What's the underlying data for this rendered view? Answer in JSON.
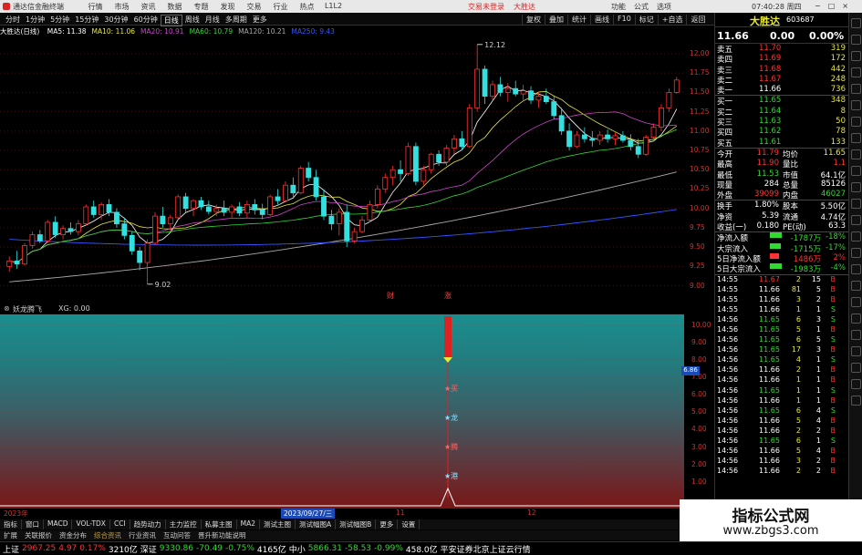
{
  "titlebar": {
    "app_title": "通达信金融终端",
    "menu": [
      "行情",
      "市场",
      "资讯",
      "数据",
      "专题",
      "发现",
      "交易",
      "行业",
      "热点",
      "L1L2"
    ],
    "links": [
      "交易未登录",
      "大胜达"
    ],
    "right_menu": [
      "功能",
      "公式",
      "选项"
    ],
    "clock": "07:40:28",
    "clock_label": "周四",
    "win_buttons": [
      "−",
      "□",
      "×"
    ]
  },
  "toolbar": {
    "periods": [
      "分时",
      "1分钟",
      "5分钟",
      "15分钟",
      "30分钟",
      "60分钟",
      "日线",
      "周线",
      "月线",
      "多周期",
      "更多"
    ],
    "active_period": "日线",
    "actions": [
      "复权",
      "叠加",
      "统计",
      "画线",
      "F10",
      "标记",
      "+自选",
      "返回"
    ]
  },
  "ma_line": {
    "title": "大胜达(日线)",
    "items": [
      {
        "label": "MA5: 11.38",
        "color": "#ffffff"
      },
      {
        "label": "MA10: 11.06",
        "color": "#e8e838"
      },
      {
        "label": "MA20: 10.91",
        "color": "#cc44cc"
      },
      {
        "label": "MA60: 10.79",
        "color": "#33d933"
      },
      {
        "label": "MA120: 10.21",
        "color": "#aaaaaa"
      },
      {
        "label": "MA250: 9.43",
        "color": "#3355ff"
      }
    ]
  },
  "chart_data": {
    "type": "candlestick",
    "ylim": [
      8.9,
      12.2
    ],
    "y_ticks": [
      "12.00",
      "11.75",
      "11.50",
      "11.25",
      "11.00",
      "10.75",
      "10.50",
      "10.25",
      "10.00",
      "9.75",
      "9.50",
      "9.25",
      "9.00"
    ],
    "annotations": [
      {
        "text": "12.12"
      },
      {
        "text": "9.02"
      }
    ],
    "candles": [
      {
        "o": 9.25,
        "h": 9.38,
        "l": 9.18,
        "c": 9.32
      },
      {
        "o": 9.32,
        "h": 9.45,
        "l": 9.22,
        "c": 9.28
      },
      {
        "o": 9.28,
        "h": 9.55,
        "l": 9.26,
        "c": 9.52
      },
      {
        "o": 9.52,
        "h": 9.7,
        "l": 9.48,
        "c": 9.66
      },
      {
        "o": 9.66,
        "h": 9.72,
        "l": 9.55,
        "c": 9.58
      },
      {
        "o": 9.58,
        "h": 9.85,
        "l": 9.55,
        "c": 9.82
      },
      {
        "o": 9.82,
        "h": 9.9,
        "l": 9.62,
        "c": 9.66
      },
      {
        "o": 9.66,
        "h": 9.78,
        "l": 9.6,
        "c": 9.74
      },
      {
        "o": 9.74,
        "h": 9.82,
        "l": 9.66,
        "c": 9.7
      },
      {
        "o": 9.7,
        "h": 9.85,
        "l": 9.65,
        "c": 9.8
      },
      {
        "o": 9.8,
        "h": 10.05,
        "l": 9.78,
        "c": 10.02
      },
      {
        "o": 10.02,
        "h": 10.1,
        "l": 9.88,
        "c": 9.92
      },
      {
        "o": 9.92,
        "h": 10.08,
        "l": 9.85,
        "c": 10.05
      },
      {
        "o": 10.05,
        "h": 10.12,
        "l": 9.9,
        "c": 9.95
      },
      {
        "o": 9.95,
        "h": 10.0,
        "l": 9.75,
        "c": 9.8
      },
      {
        "o": 9.8,
        "h": 9.88,
        "l": 9.6,
        "c": 9.65
      },
      {
        "o": 9.65,
        "h": 9.7,
        "l": 9.4,
        "c": 9.45
      },
      {
        "o": 9.45,
        "h": 9.5,
        "l": 9.2,
        "c": 9.3
      },
      {
        "o": 9.3,
        "h": 9.6,
        "l": 9.02,
        "c": 9.55
      },
      {
        "o": 9.55,
        "h": 9.95,
        "l": 9.52,
        "c": 9.9
      },
      {
        "o": 9.9,
        "h": 10.02,
        "l": 9.75,
        "c": 9.8
      },
      {
        "o": 9.8,
        "h": 9.92,
        "l": 9.7,
        "c": 9.88
      },
      {
        "o": 9.88,
        "h": 10.18,
        "l": 9.85,
        "c": 10.15
      },
      {
        "o": 10.15,
        "h": 10.2,
        "l": 9.95,
        "c": 10.0
      },
      {
        "o": 10.0,
        "h": 10.12,
        "l": 9.9,
        "c": 10.1
      },
      {
        "o": 10.1,
        "h": 10.15,
        "l": 9.98,
        "c": 10.02
      },
      {
        "o": 10.02,
        "h": 10.1,
        "l": 9.92,
        "c": 9.96
      },
      {
        "o": 9.96,
        "h": 10.05,
        "l": 9.9,
        "c": 10.0
      },
      {
        "o": 10.0,
        "h": 10.1,
        "l": 9.9,
        "c": 9.95
      },
      {
        "o": 9.95,
        "h": 10.05,
        "l": 9.88,
        "c": 10.02
      },
      {
        "o": 10.02,
        "h": 10.08,
        "l": 9.9,
        "c": 9.94
      },
      {
        "o": 9.94,
        "h": 10.1,
        "l": 9.88,
        "c": 10.05
      },
      {
        "o": 10.05,
        "h": 10.12,
        "l": 9.92,
        "c": 9.98
      },
      {
        "o": 9.98,
        "h": 10.06,
        "l": 9.86,
        "c": 9.92
      },
      {
        "o": 9.92,
        "h": 10.18,
        "l": 9.9,
        "c": 10.15
      },
      {
        "o": 10.15,
        "h": 10.25,
        "l": 10.05,
        "c": 10.1
      },
      {
        "o": 10.1,
        "h": 10.35,
        "l": 10.08,
        "c": 10.3
      },
      {
        "o": 10.3,
        "h": 10.4,
        "l": 10.15,
        "c": 10.2
      },
      {
        "o": 10.2,
        "h": 10.55,
        "l": 10.18,
        "c": 10.52
      },
      {
        "o": 10.52,
        "h": 10.6,
        "l": 10.35,
        "c": 10.4
      },
      {
        "o": 10.4,
        "h": 10.5,
        "l": 10.1,
        "c": 10.15
      },
      {
        "o": 10.15,
        "h": 10.25,
        "l": 9.85,
        "c": 9.9
      },
      {
        "o": 9.9,
        "h": 9.98,
        "l": 9.72,
        "c": 9.8
      },
      {
        "o": 9.8,
        "h": 10.0,
        "l": 9.65,
        "c": 9.95
      },
      {
        "o": 9.95,
        "h": 10.05,
        "l": 9.5,
        "c": 9.58
      },
      {
        "o": 9.58,
        "h": 9.75,
        "l": 9.55,
        "c": 9.7
      },
      {
        "o": 9.7,
        "h": 9.9,
        "l": 9.68,
        "c": 9.85
      },
      {
        "o": 9.85,
        "h": 10.1,
        "l": 9.82,
        "c": 10.05
      },
      {
        "o": 10.05,
        "h": 10.3,
        "l": 10.0,
        "c": 10.25
      },
      {
        "o": 10.25,
        "h": 10.45,
        "l": 10.2,
        "c": 10.4
      },
      {
        "o": 10.4,
        "h": 10.55,
        "l": 10.3,
        "c": 10.5
      },
      {
        "o": 10.5,
        "h": 10.62,
        "l": 10.35,
        "c": 10.45
      },
      {
        "o": 10.45,
        "h": 10.85,
        "l": 10.42,
        "c": 10.8
      },
      {
        "o": 10.8,
        "h": 10.85,
        "l": 10.3,
        "c": 10.35
      },
      {
        "o": 10.35,
        "h": 10.55,
        "l": 10.3,
        "c": 10.5
      },
      {
        "o": 10.5,
        "h": 10.72,
        "l": 10.45,
        "c": 10.7
      },
      {
        "o": 10.7,
        "h": 10.75,
        "l": 10.55,
        "c": 10.6
      },
      {
        "o": 10.6,
        "h": 10.82,
        "l": 10.55,
        "c": 10.78
      },
      {
        "o": 10.78,
        "h": 10.95,
        "l": 10.7,
        "c": 10.9
      },
      {
        "o": 10.9,
        "h": 11.0,
        "l": 10.75,
        "c": 10.8
      },
      {
        "o": 10.8,
        "h": 11.35,
        "l": 10.78,
        "c": 11.3
      },
      {
        "o": 11.3,
        "h": 12.12,
        "l": 11.25,
        "c": 11.8
      },
      {
        "o": 11.8,
        "h": 11.85,
        "l": 11.35,
        "c": 11.45
      },
      {
        "o": 11.45,
        "h": 11.65,
        "l": 11.4,
        "c": 11.6
      },
      {
        "o": 11.6,
        "h": 11.7,
        "l": 11.45,
        "c": 11.5
      },
      {
        "o": 11.5,
        "h": 11.62,
        "l": 11.38,
        "c": 11.55
      },
      {
        "o": 11.55,
        "h": 11.65,
        "l": 11.45,
        "c": 11.48
      },
      {
        "o": 11.48,
        "h": 11.6,
        "l": 11.4,
        "c": 11.52
      },
      {
        "o": 11.52,
        "h": 11.58,
        "l": 11.35,
        "c": 11.4
      },
      {
        "o": 11.4,
        "h": 11.5,
        "l": 11.3,
        "c": 11.45
      },
      {
        "o": 11.45,
        "h": 11.55,
        "l": 11.35,
        "c": 11.38
      },
      {
        "o": 11.38,
        "h": 11.45,
        "l": 11.15,
        "c": 11.2
      },
      {
        "o": 11.2,
        "h": 11.3,
        "l": 10.95,
        "c": 11.0
      },
      {
        "o": 11.0,
        "h": 11.1,
        "l": 10.75,
        "c": 10.8
      },
      {
        "o": 10.8,
        "h": 11.0,
        "l": 10.78,
        "c": 10.95
      },
      {
        "o": 10.95,
        "h": 11.05,
        "l": 10.85,
        "c": 10.9
      },
      {
        "o": 10.9,
        "h": 11.0,
        "l": 10.8,
        "c": 10.88
      },
      {
        "o": 10.88,
        "h": 11.0,
        "l": 10.82,
        "c": 10.95
      },
      {
        "o": 10.95,
        "h": 11.02,
        "l": 10.85,
        "c": 10.9
      },
      {
        "o": 10.9,
        "h": 10.98,
        "l": 10.82,
        "c": 10.94
      },
      {
        "o": 10.94,
        "h": 11.0,
        "l": 10.85,
        "c": 10.88
      },
      {
        "o": 10.88,
        "h": 10.96,
        "l": 10.75,
        "c": 10.8
      },
      {
        "o": 10.8,
        "h": 10.9,
        "l": 10.65,
        "c": 10.7
      },
      {
        "o": 10.7,
        "h": 10.95,
        "l": 10.68,
        "c": 10.92
      },
      {
        "o": 10.92,
        "h": 11.1,
        "l": 10.9,
        "c": 11.05
      },
      {
        "o": 11.05,
        "h": 11.35,
        "l": 11.0,
        "c": 11.3
      },
      {
        "o": 11.3,
        "h": 11.55,
        "l": 11.25,
        "c": 11.5
      },
      {
        "o": 11.5,
        "h": 11.7,
        "l": 11.48,
        "c": 11.66
      }
    ]
  },
  "indicator": {
    "name": "妖龙腾飞",
    "value_label": "XG: 0.00",
    "y_ticks": [
      "10.00",
      "9.00",
      "8.00",
      "7.00",
      "6.00",
      "5.00",
      "4.00",
      "3.00",
      "2.00",
      "1.00"
    ],
    "cursor_value": "6.86",
    "signal_labels": [
      "财",
      "涨"
    ],
    "vertical_labels": [
      "买",
      "龙",
      "腾",
      "港"
    ]
  },
  "time_axis": {
    "labels": [
      "2023年",
      "2023/09/27/三",
      "11",
      "12"
    ]
  },
  "tabs": [
    "指标",
    "窗口",
    "MACD",
    "VOL-TDX",
    "CCI",
    "趋势动力",
    "主力监控",
    "私募主图",
    "MA2",
    "测试主图",
    "测试幅图A",
    "测试幅图B",
    "更多",
    "设置"
  ],
  "tabs2": [
    {
      "text": "扩展",
      "hl": false
    },
    {
      "text": "关联报价",
      "hl": false
    },
    {
      "text": "资金分布",
      "hl": false
    },
    {
      "text": "综合资讯",
      "hl": true
    },
    {
      "text": "行业资讯",
      "hl": false
    },
    {
      "text": "互动问答",
      "hl": false
    },
    {
      "text": "晋升新功能说明",
      "hl": false
    }
  ],
  "ticker": [
    {
      "text": "上证",
      "cls": "white"
    },
    {
      "text": "2967.25",
      "cls": "red"
    },
    {
      "text": "4.97",
      "cls": "red"
    },
    {
      "text": "0.17%",
      "cls": "red"
    },
    {
      "text": "3210亿",
      "cls": "white"
    },
    {
      "text": "深证",
      "cls": "white"
    },
    {
      "text": "9330.86",
      "cls": "green"
    },
    {
      "text": "-70.49",
      "cls": "green"
    },
    {
      "text": "-0.75%",
      "cls": "green"
    },
    {
      "text": "4165亿",
      "cls": "white"
    },
    {
      "text": "中小",
      "cls": "white"
    },
    {
      "text": "5866.31",
      "cls": "green"
    },
    {
      "text": "-58.53",
      "cls": "green"
    },
    {
      "text": "-0.99%",
      "cls": "green"
    },
    {
      "text": "458.0亿",
      "cls": "white"
    },
    {
      "text": "平安证券北京上证云行情",
      "cls": "white"
    }
  ],
  "stock": {
    "name": "大胜达",
    "code": "603687",
    "price": "11.66",
    "change": "0.00",
    "pct": "0.00%"
  },
  "orderbook": {
    "asks": [
      {
        "label": "卖五",
        "price": "11.70",
        "vol": "319"
      },
      {
        "label": "卖四",
        "price": "11.69",
        "vol": "172"
      },
      {
        "label": "卖三",
        "price": "11.68",
        "vol": "442"
      },
      {
        "label": "卖二",
        "price": "11.67",
        "vol": "248"
      },
      {
        "label": "卖一",
        "price": "11.66",
        "vol": "736"
      }
    ],
    "bids": [
      {
        "label": "买一",
        "price": "11.65",
        "vol": "348"
      },
      {
        "label": "买二",
        "price": "11.64",
        "vol": "8"
      },
      {
        "label": "买三",
        "price": "11.63",
        "vol": "50"
      },
      {
        "label": "买四",
        "price": "11.62",
        "vol": "78"
      },
      {
        "label": "买五",
        "price": "11.61",
        "vol": "133"
      }
    ]
  },
  "stats": [
    {
      "l1": "今开",
      "v1": "11.79",
      "c1": "red",
      "l2": "均价",
      "v2": "11.65",
      "c2": "yellow"
    },
    {
      "l1": "最高",
      "v1": "11.90",
      "c1": "red",
      "l2": "量比",
      "v2": "1.1",
      "c2": "red"
    },
    {
      "l1": "最低",
      "v1": "11.53",
      "c1": "green",
      "l2": "市值",
      "v2": "64.1亿",
      "c2": "white"
    },
    {
      "l1": "现量",
      "v1": "284",
      "c1": "white",
      "l2": "总量",
      "v2": "85126",
      "c2": "white"
    },
    {
      "l1": "外盘",
      "v1": "39099",
      "c1": "red",
      "l2": "内盘",
      "v2": "46027",
      "c2": "green"
    }
  ],
  "stats2": [
    {
      "l1": "换手",
      "v1": "1.80%",
      "l2": "股本",
      "v2": "5.50亿"
    },
    {
      "l1": "净资",
      "v1": "5.39",
      "l2": "流通",
      "v2": "4.74亿"
    },
    {
      "l1": "收益(一)",
      "v1": "0.180",
      "l2": "PE(动)",
      "v2": "63.3"
    }
  ],
  "flows": [
    {
      "label": "净流入额",
      "value": "-1787万",
      "pct": "-18%",
      "cls": "green",
      "bar": 0.9
    },
    {
      "label": "大宗流入",
      "value": "-1715万",
      "pct": "-17%",
      "cls": "green",
      "bar": 0.86
    },
    {
      "label": "5日净流入额",
      "value": "1486万",
      "pct": "2%",
      "cls": "red",
      "bar": 0.72
    },
    {
      "label": "5日大宗流入",
      "value": "-1983万",
      "pct": "-4%",
      "cls": "green",
      "bar": 0.95
    }
  ],
  "ticks": [
    {
      "t": "14:55",
      "p": "11.67",
      "v": "2",
      "n": "15",
      "s": "B",
      "pc": "red",
      "sc": "red"
    },
    {
      "t": "14:55",
      "p": "11.66",
      "v": "81",
      "n": "5",
      "s": "B",
      "pc": "white",
      "sc": "red"
    },
    {
      "t": "14:55",
      "p": "11.66",
      "v": "3",
      "n": "2",
      "s": "B",
      "pc": "white",
      "sc": "red"
    },
    {
      "t": "14:55",
      "p": "11.66",
      "v": "1",
      "n": "1",
      "s": "S",
      "pc": "white",
      "sc": "green"
    },
    {
      "t": "14:56",
      "p": "11.65",
      "v": "6",
      "n": "3",
      "s": "S",
      "pc": "green",
      "sc": "green"
    },
    {
      "t": "14:56",
      "p": "11.65",
      "v": "5",
      "n": "1",
      "s": "B",
      "pc": "green",
      "sc": "red"
    },
    {
      "t": "14:56",
      "p": "11.65",
      "v": "6",
      "n": "5",
      "s": "S",
      "pc": "green",
      "sc": "green"
    },
    {
      "t": "14:56",
      "p": "11.65",
      "v": "17",
      "n": "3",
      "s": "B",
      "pc": "green",
      "sc": "red"
    },
    {
      "t": "14:56",
      "p": "11.65",
      "v": "4",
      "n": "1",
      "s": "S",
      "pc": "green",
      "sc": "green"
    },
    {
      "t": "14:56",
      "p": "11.66",
      "v": "2",
      "n": "1",
      "s": "B",
      "pc": "white",
      "sc": "red"
    },
    {
      "t": "14:56",
      "p": "11.66",
      "v": "1",
      "n": "1",
      "s": "B",
      "pc": "white",
      "sc": "red"
    },
    {
      "t": "14:56",
      "p": "11.65",
      "v": "1",
      "n": "1",
      "s": "S",
      "pc": "green",
      "sc": "green"
    },
    {
      "t": "14:56",
      "p": "11.66",
      "v": "1",
      "n": "1",
      "s": "B",
      "pc": "white",
      "sc": "red"
    },
    {
      "t": "14:56",
      "p": "11.65",
      "v": "6",
      "n": "4",
      "s": "S",
      "pc": "green",
      "sc": "green"
    },
    {
      "t": "14:56",
      "p": "11.66",
      "v": "5",
      "n": "4",
      "s": "B",
      "pc": "white",
      "sc": "red"
    },
    {
      "t": "14:56",
      "p": "11.66",
      "v": "2",
      "n": "2",
      "s": "B",
      "pc": "white",
      "sc": "red"
    },
    {
      "t": "14:56",
      "p": "11.65",
      "v": "6",
      "n": "1",
      "s": "S",
      "pc": "green",
      "sc": "green"
    },
    {
      "t": "14:56",
      "p": "11.66",
      "v": "5",
      "n": "4",
      "s": "B",
      "pc": "white",
      "sc": "red"
    },
    {
      "t": "14:56",
      "p": "11.66",
      "v": "3",
      "n": "2",
      "s": "B",
      "pc": "white",
      "sc": "red"
    },
    {
      "t": "14:56",
      "p": "11.66",
      "v": "2",
      "n": "2",
      "s": "B",
      "pc": "white",
      "sc": "red"
    }
  ],
  "watermark": {
    "line1": "指标公式网",
    "line2": "www.zbgs3.com"
  }
}
